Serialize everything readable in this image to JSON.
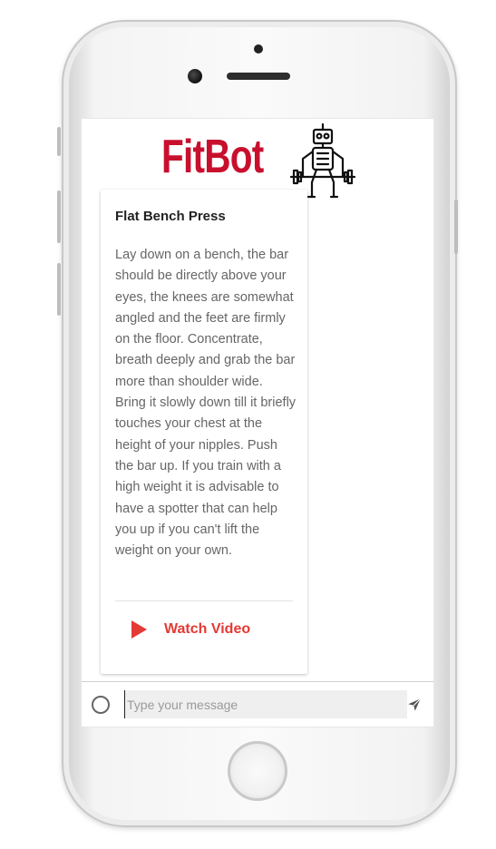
{
  "app": {
    "logo_text": "FitBot",
    "brand_color": "#c8102e",
    "accent_color": "#e53935"
  },
  "card": {
    "title": "Flat Bench Press",
    "description": "Lay down on a bench, the bar should be directly above your eyes, the knees are somewhat angled and the feet are firmly on the floor. Concentrate, breath deeply and grab the bar more than shoulder wide. Bring it slowly down till it briefly touches your chest at the height of your nipples. Push the bar up. If you train with a high weight it is advisable to have a spotter that can help you up if you can't lift the weight on your own.",
    "watch_label": "Watch Video",
    "watch_icon": "play-icon"
  },
  "composer": {
    "placeholder": "Type your message",
    "value": "",
    "left_icon": "circle-icon",
    "send_icon": "send-icon"
  }
}
